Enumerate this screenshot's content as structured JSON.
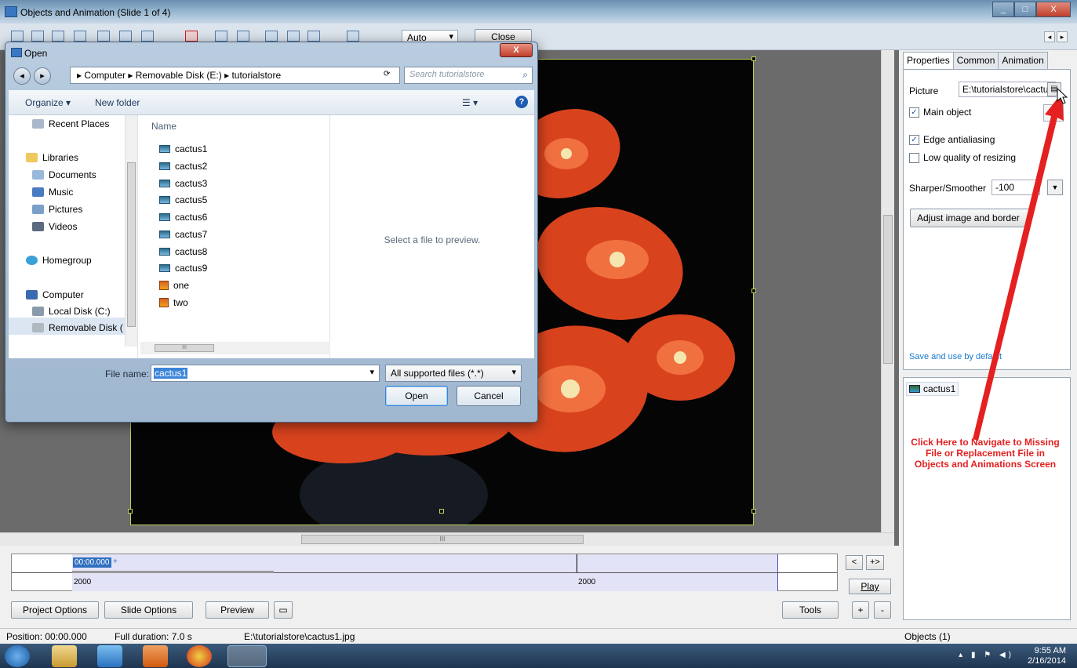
{
  "window": {
    "title": "Objects and Animation  (Slide 1 of 4)",
    "controls": [
      "_",
      "□",
      "X"
    ]
  },
  "toolbar": {
    "zoom_value": "Auto",
    "close_label": "Close"
  },
  "dialog": {
    "title": "Open",
    "close_glyph": "X",
    "address": "▸ Computer ▸ Removable Disk (E:) ▸ tutorialstore",
    "search_placeholder": "Search tutorialstore",
    "organize_label": "Organize ▾",
    "new_folder_label": "New folder",
    "help_glyph": "?",
    "nav_items": [
      "Recent Places",
      "Libraries",
      "Documents",
      "Music",
      "Pictures",
      "Videos",
      "Homegroup",
      "Computer",
      "Local Disk (C:)",
      "Removable Disk ("
    ],
    "column_header": "Name",
    "files": [
      {
        "name": "cactus1",
        "type": "image"
      },
      {
        "name": "cactus2",
        "type": "image"
      },
      {
        "name": "cactus3",
        "type": "image"
      },
      {
        "name": "cactus5",
        "type": "image"
      },
      {
        "name": "cactus6",
        "type": "image"
      },
      {
        "name": "cactus7",
        "type": "image"
      },
      {
        "name": "cactus8",
        "type": "image"
      },
      {
        "name": "cactus9",
        "type": "image"
      },
      {
        "name": "one",
        "type": "presentation"
      },
      {
        "name": "two",
        "type": "presentation"
      }
    ],
    "preview_text": "Select a file to preview.",
    "file_name_label": "File name:",
    "file_name_value": "cactus1",
    "file_type": "All supported files (*.*)",
    "open_label": "Open",
    "cancel_label": "Cancel"
  },
  "timeline": {
    "time_value": "00:00.000",
    "plus": "+",
    "row2_left": "2000",
    "row2_mid": "2000",
    "prev_btn": "<",
    "add_btn": "+>",
    "play_label": "Play",
    "project_options": "Project Options",
    "slide_options": "Slide Options",
    "preview_label": "Preview",
    "tools_label": "Tools",
    "plus_btn": "+",
    "minus_btn": "-"
  },
  "status": {
    "position": "Position: 00:00.000",
    "duration": "Full duration: 7.0 s",
    "path": "E:\\tutorialstore\\cactus1.jpg",
    "objects": "Objects (1)"
  },
  "properties": {
    "tabs": [
      "Properties",
      "Common",
      "Animation"
    ],
    "picture_label": "Picture",
    "picture_value": "E:\\tutorialstore\\cactu",
    "main_object": "Main object",
    "edge_antialiasing": "Edge antialiasing",
    "low_quality": "Low quality of resizing",
    "sharper_label": "Sharper/Smoother",
    "sharper_value": "-100",
    "adjust_label": "Adjust image and border",
    "save_default": "Save and use by default",
    "object_item": "cactus1",
    "annotation": "Click Here to Navigate to Missing File or Replacement File in Objects and Animations Screen"
  },
  "taskbar": {
    "time": "9:55 AM",
    "date": "2/16/2014"
  },
  "colors": {
    "annotation": "#e42020",
    "selection": "#3a84d8",
    "timeline_fill": "#e3e3f7",
    "frame_border": "#b9d05a"
  }
}
